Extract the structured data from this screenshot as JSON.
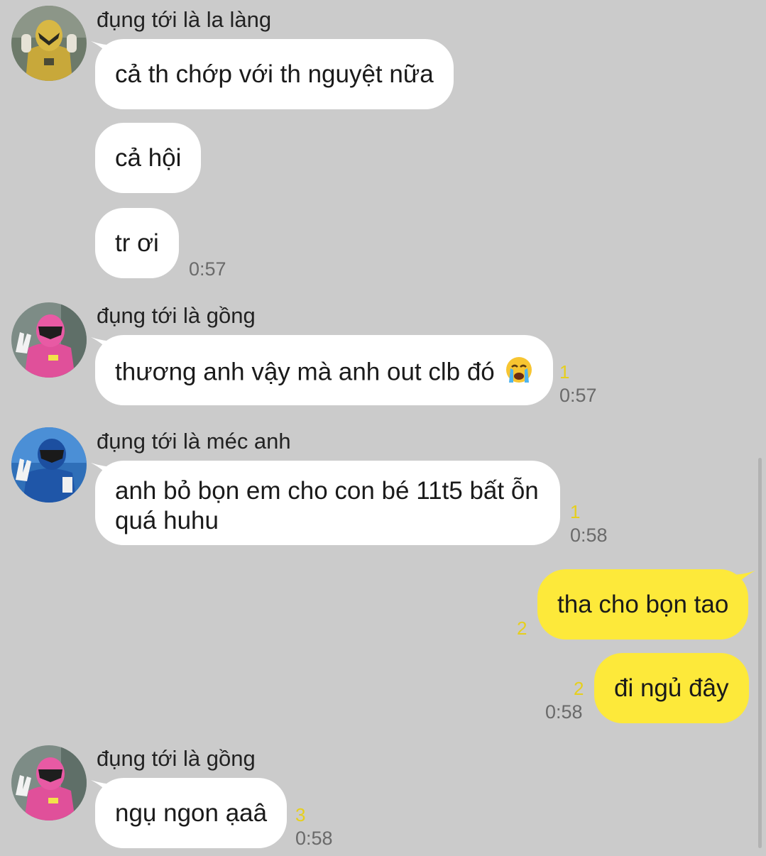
{
  "colors": {
    "background": "#cbcbcb",
    "incoming_bubble": "#ffffff",
    "outgoing_bubble": "#fde93a",
    "unread_count": "#e6cf1d",
    "time": "#6a6a6a"
  },
  "messages": [
    {
      "sender": "đụng tới là la làng",
      "avatar": "yellow-ranger-avatar",
      "lines": [
        "cả th chớp với th nguyệt nữa",
        "cả hội",
        "tr ơi"
      ],
      "time": "0:57"
    },
    {
      "sender": "đụng tới là gồng",
      "avatar": "pink-ranger-avatar",
      "text": "thương anh vậy mà anh out clb đó",
      "emoji": "crying-face-emoji",
      "unread": "1",
      "time": "0:57"
    },
    {
      "sender": "đụng tới là méc anh",
      "avatar": "blue-ranger-avatar",
      "text": "anh bỏ bọn em cho con bé 11t5 bất ỗn quá huhu",
      "unread": "1",
      "time": "0:58"
    },
    {
      "outgoing": true,
      "lines": [
        "tha cho bọn tao",
        "đi ngủ đây"
      ],
      "unread": [
        "2",
        "2"
      ],
      "time": "0:58"
    },
    {
      "sender": "đụng tới là gồng",
      "avatar": "pink-ranger-avatar",
      "text": "ngụ ngon ạaâ",
      "unread": "3",
      "time": "0:58"
    }
  ]
}
